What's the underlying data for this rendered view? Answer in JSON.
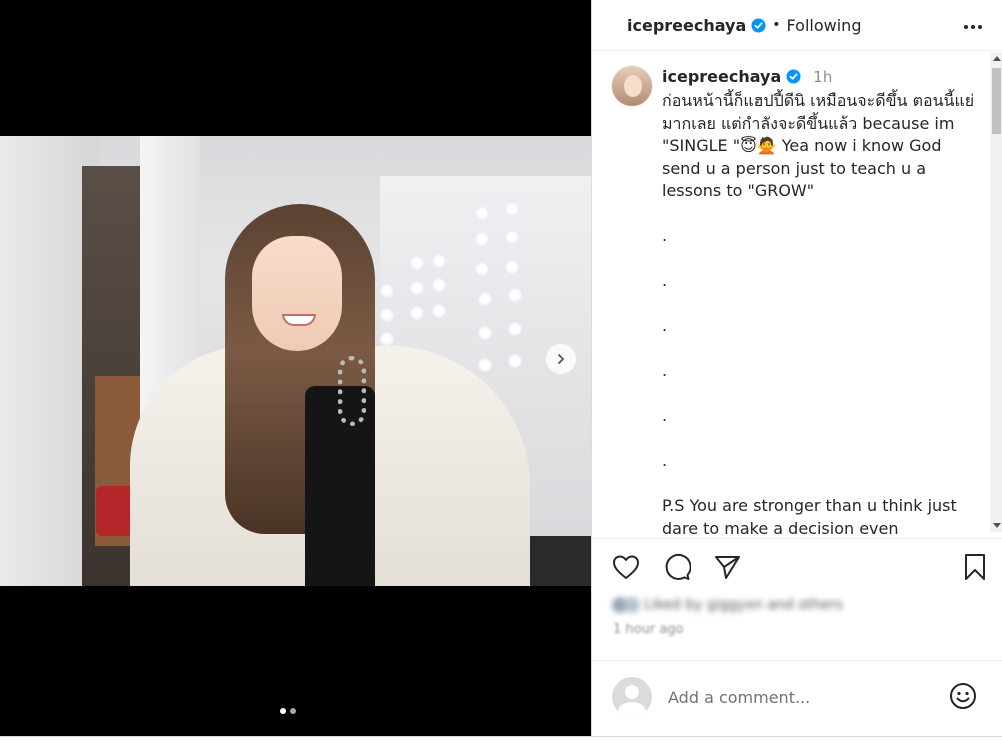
{
  "post": {
    "username": "icepreechaya",
    "follow_status": "Following",
    "separator": "•",
    "time": "1h",
    "caption": "ก่อนหน้านี้ก็แฮปปี้ดีนิ เหมือนจะดีขึ้น ตอนนี้แย่มากเลย แต่กำลังจะดีขึ้นแล้ว because im \"SINGLE \"😇🙅 Yea now i know God send u a person just to teach u a lessons to \"GROW\"\n\n.\n\n.\n\n.\n\n.\n\n.\n\n.\n\nP.S You are stronger than u think just dare to make a decision even",
    "time_ago": "1 hour ago",
    "likes_text": "Liked by giggyxn and others"
  },
  "comment": {
    "placeholder": "Add a comment..."
  },
  "carousel": {
    "total_slides": 2,
    "active_slide": 1
  },
  "icons": [
    "verified-badge-icon",
    "more-options-icon",
    "heart-icon",
    "comment-icon",
    "share-icon",
    "bookmark-icon",
    "emoji-icon",
    "chevron-right-icon"
  ],
  "colors": {
    "verified": "#0095f6",
    "text": "#262626",
    "muted": "#8e8e8e",
    "media_bg": "#000000"
  }
}
